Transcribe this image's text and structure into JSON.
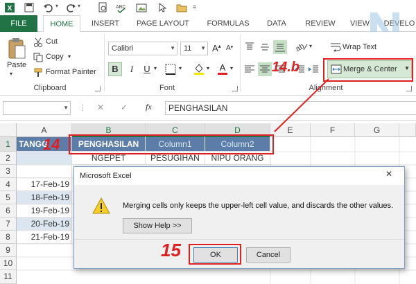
{
  "ribbon_tabs": [
    "FILE",
    "HOME",
    "INSERT",
    "PAGE LAYOUT",
    "FORMULAS",
    "DATA",
    "REVIEW",
    "VIEW",
    "DEVELO"
  ],
  "clipboard": {
    "paste": "Paste",
    "cut": "Cut",
    "copy": "Copy",
    "format_painter": "Format Painter",
    "label": "Clipboard"
  },
  "font": {
    "name": "Calibri",
    "size": "11",
    "bold": "B",
    "italic": "I",
    "underline": "U",
    "label": "Font",
    "grow": "A",
    "shrink": "A"
  },
  "alignment": {
    "wrap_text": "Wrap Text",
    "merge_center": "Merge & Center",
    "label": "Alignment"
  },
  "formula_bar": {
    "name_box": "",
    "fx": "fx",
    "cancel": "✕",
    "enter": "✓",
    "formula": "PENGHASILAN"
  },
  "columns": [
    "A",
    "B",
    "C",
    "D",
    "E",
    "F",
    "G"
  ],
  "rows": [
    "1",
    "2",
    "3",
    "4",
    "5",
    "6",
    "7",
    "8",
    "9",
    "10",
    "11"
  ],
  "cells": {
    "a1": "TANGG",
    "b1": "PENGHASILAN",
    "c1": "Column1",
    "d1": "Column2",
    "b2": "NGEPET",
    "c2": "PESUGIHAN",
    "d2": "NIPU ORANG",
    "a4": "17-Feb-19",
    "a5": "18-Feb-19",
    "a6": "19-Feb-19",
    "a7": "20-Feb-19",
    "a8": "21-Feb-19"
  },
  "dialog": {
    "title": "Microsoft Excel",
    "close": "✕",
    "message": "Merging cells only keeps the upper-left cell value, and discards the other values.",
    "show_help": "Show Help >>",
    "ok": "OK",
    "cancel": "Cancel"
  },
  "annotations": {
    "step_merge": "14.b",
    "step_select": "14",
    "step_ok": "15"
  },
  "colors": {
    "accent": "#217346",
    "annotation": "#e02020",
    "header_fill": "#5b7da8"
  }
}
